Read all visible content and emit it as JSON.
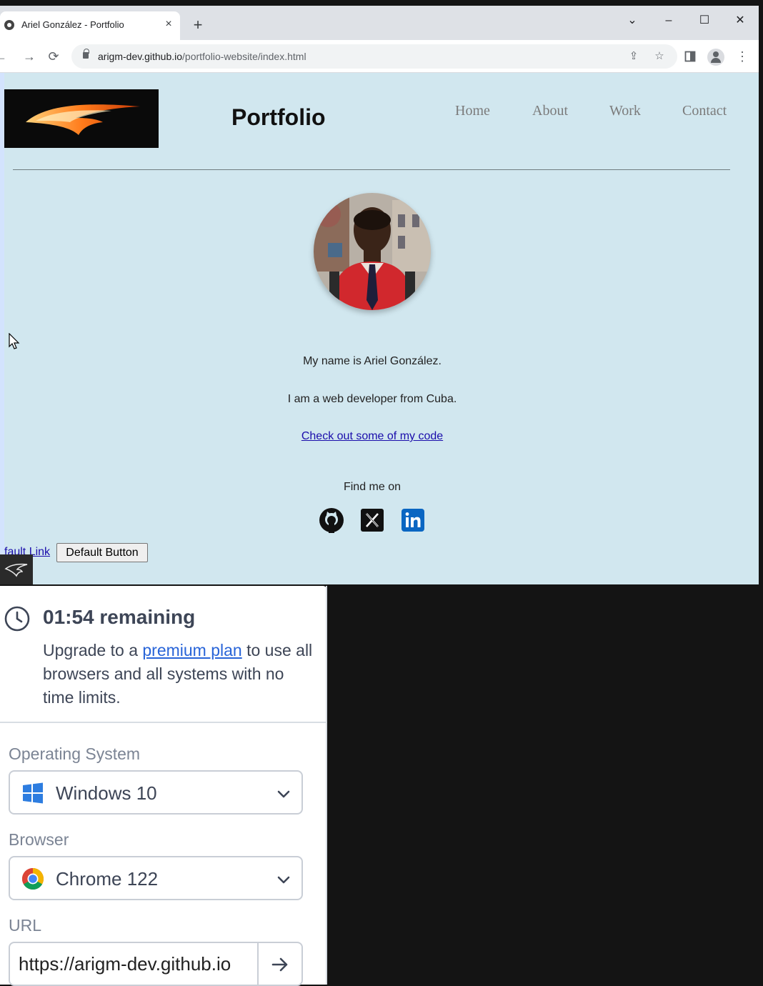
{
  "browser": {
    "tab_title": "Ariel González - Portfolio",
    "tab_close": "×",
    "new_tab": "+",
    "url_host": "arigm-dev.github.io",
    "url_path": "/portfolio-website/index.html",
    "window_controls": {
      "tab_search": "⌄",
      "minimize": "–",
      "maximize": "☐",
      "close": "✕"
    }
  },
  "page": {
    "title": "Portfolio",
    "nav": [
      "Home",
      "About",
      "Work",
      "Contact"
    ],
    "intro_name": "My name is Ariel González.",
    "intro_role": "I am a web developer from Cuba.",
    "code_link": "Check out some of my code",
    "find_me": "Find me on",
    "social_icons": [
      "github-icon",
      "x-icon",
      "linkedin-icon"
    ],
    "default_link": "fault Link",
    "default_button": "Default Button"
  },
  "panel": {
    "timer": "01:54 remaining",
    "upgrade_pre": "Upgrade to a ",
    "upgrade_link": "premium plan",
    "upgrade_post": " to use all browsers and all systems with no time limits.",
    "os_label": "Operating System",
    "os_value": "Windows 10",
    "browser_label": "Browser",
    "browser_value": "Chrome 122",
    "url_label": "URL",
    "url_value": "https://arigm-dev.github.io"
  },
  "colors": {
    "page_bg": "#d1e7ef",
    "link": "#1a0dab",
    "panel_link": "#2864d8",
    "linkedin": "#0a66c2"
  }
}
